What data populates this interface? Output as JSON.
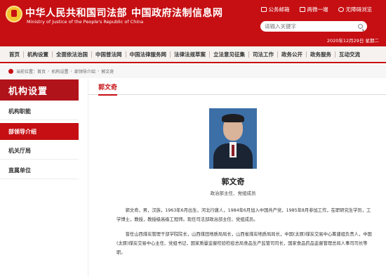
{
  "header": {
    "title_cn": "中华人民共和国司法部",
    "title_cn2": "中国政府法制信息网",
    "subtitle_en": "Ministry of Justice of the People's Republic of China",
    "links": [
      {
        "label": "公务邮箱",
        "icon": "mail-icon"
      },
      {
        "label": "两微一端",
        "icon": "mobile-icon"
      },
      {
        "label": "无障碍浏览",
        "icon": "accessibility-icon"
      }
    ],
    "search_placeholder": "请输入关键字",
    "date": "2020年12月29日 星期二"
  },
  "nav": [
    "首页",
    "机构设置",
    "全面依法治国",
    "中国普法网",
    "中国法律服务网",
    "法律法规草案",
    "立法意见征集",
    "司法工作",
    "政务公开",
    "政务服务",
    "互动交流"
  ],
  "breadcrumb": [
    "当前位置：",
    "首页",
    "机构设置",
    "部领导介绍",
    "郭文奇"
  ],
  "sidebar": {
    "title": "机构设置",
    "items": [
      {
        "label": "机构职能"
      },
      {
        "label": "部领导介绍"
      },
      {
        "label": "机关厅局"
      },
      {
        "label": "直属单位"
      }
    ]
  },
  "main": {
    "title": "郭文奇",
    "name": "郭文奇",
    "role": "政治部主任、党组成员",
    "bio": [
      "郭文奇，男，汉族，1963年6月出生，河北行唐人，1984年6月加入中国共产党，1985年8月参加工作，在职研究生学历，工学博士，教授，教授级高级工程师。现任司法部政治部主任、党组成员。",
      "曾任山西煤炭管理干部学院院长，山西煤田地质局局长，山西省煤炭地质局局长，中国(太原)煤炭交易中心筹建组负责人，中国(太原)煤炭交易中心主任、党组书记，国家质量监督检验检疫总局食品生产监管司司长，国家食品药品监督管理总局人事司司长等职。"
    ]
  },
  "colors": {
    "brand_red": "#c60f13",
    "sidebar_title": "#b1131a"
  }
}
